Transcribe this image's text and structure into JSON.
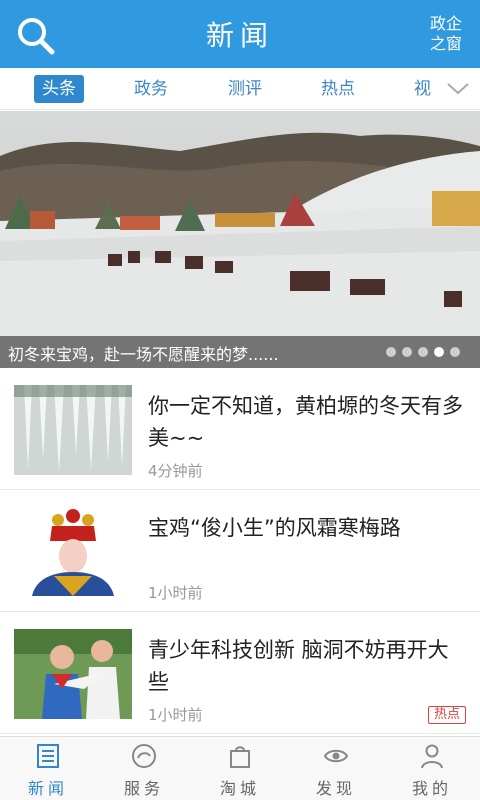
{
  "header": {
    "title": "新闻",
    "gov_window": "政企之窗",
    "search_icon": "search-icon"
  },
  "tabs": [
    {
      "label": "头条",
      "active": true
    },
    {
      "label": "政务",
      "active": false
    },
    {
      "label": "测评",
      "active": false
    },
    {
      "label": "热点",
      "active": false
    },
    {
      "label": "视",
      "active": false
    }
  ],
  "banner": {
    "caption": "初冬来宝鸡，赴一场不愿醒来的梦......",
    "dots": 5,
    "active_dot": 4
  },
  "news": [
    {
      "title": "你一定不知道，黄柏塬的冬天有多美~~",
      "time": "4分钟前",
      "badge": ""
    },
    {
      "title": "宝鸡“俊小生”的风霜寒梅路",
      "time": "1小时前",
      "badge": ""
    },
    {
      "title": "青少年科技创新 脑洞不妨再开大些",
      "time": "1小时前",
      "badge": "热点"
    }
  ],
  "bottom_nav": [
    {
      "label": "新闻",
      "icon": "news-icon",
      "active": true
    },
    {
      "label": "服务",
      "icon": "service-icon",
      "active": false
    },
    {
      "label": "淘城",
      "icon": "shopping-bag-icon",
      "active": false
    },
    {
      "label": "发现",
      "icon": "discover-eye-icon",
      "active": false
    },
    {
      "label": "我的",
      "icon": "profile-icon",
      "active": false
    }
  ],
  "colors": {
    "primary": "#2f9ae0",
    "tab_text": "#3d86c6",
    "hot": "#e04040"
  }
}
